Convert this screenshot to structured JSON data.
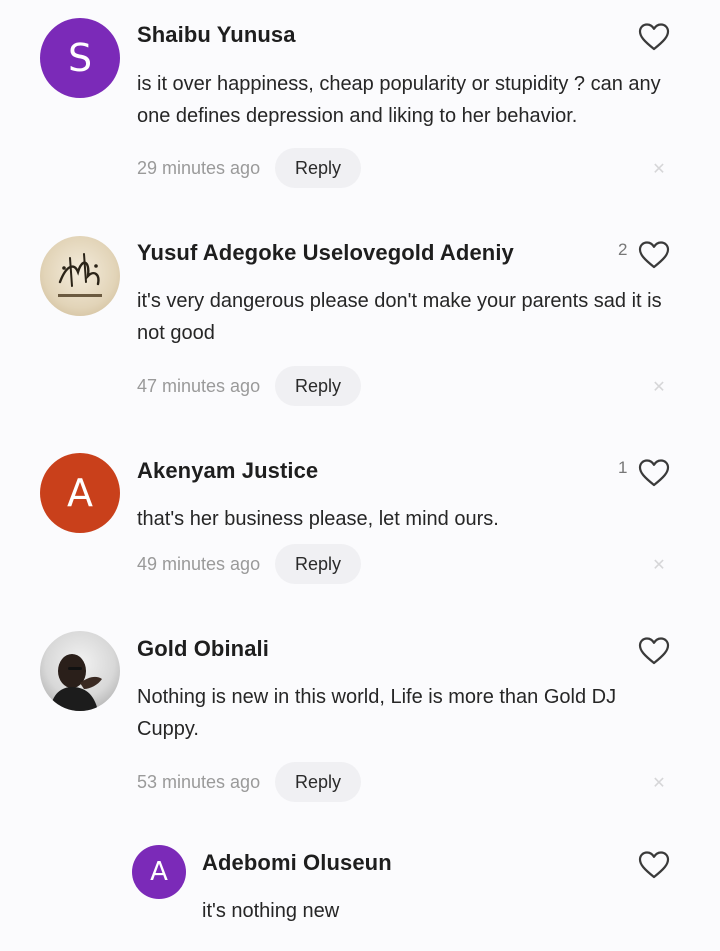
{
  "comments": [
    {
      "name": "Shaibu Yunusa",
      "avatar_letter": "S",
      "avatar_color": "#7b2ab8",
      "text": "is it over happiness, cheap popularity or stupidity ? can any one defines depression and liking to her behavior.",
      "time": "29 minutes ago",
      "reply_label": "Reply",
      "likes": ""
    },
    {
      "name": "Yusuf Adegoke Uselovegold Adeniy",
      "avatar_letter": "",
      "avatar_color": "#e8dcc4",
      "text": "it's very dangerous please don't make your parents sad it is not good",
      "time": "47 minutes ago",
      "reply_label": "Reply",
      "likes": "2"
    },
    {
      "name": "Akenyam Justice",
      "avatar_letter": "A",
      "avatar_color": "#c9401b",
      "text": "that's her business please, let mind ours.",
      "time": "49 minutes ago",
      "reply_label": "Reply",
      "likes": "1"
    },
    {
      "name": "Gold Obinali",
      "avatar_letter": "",
      "avatar_color": "#5a5a5a",
      "text": "Nothing is new in this world, Life is more than Gold  DJ Cuppy.",
      "time": "53 minutes ago",
      "reply_label": "Reply",
      "likes": ""
    }
  ],
  "reply": {
    "name": "Adebomi Oluseun",
    "avatar_letter": "A",
    "avatar_color": "#7b2ab8",
    "text": "it's nothing new"
  },
  "icons": {
    "like": "heart-outline-icon",
    "dismiss": "close-icon"
  }
}
